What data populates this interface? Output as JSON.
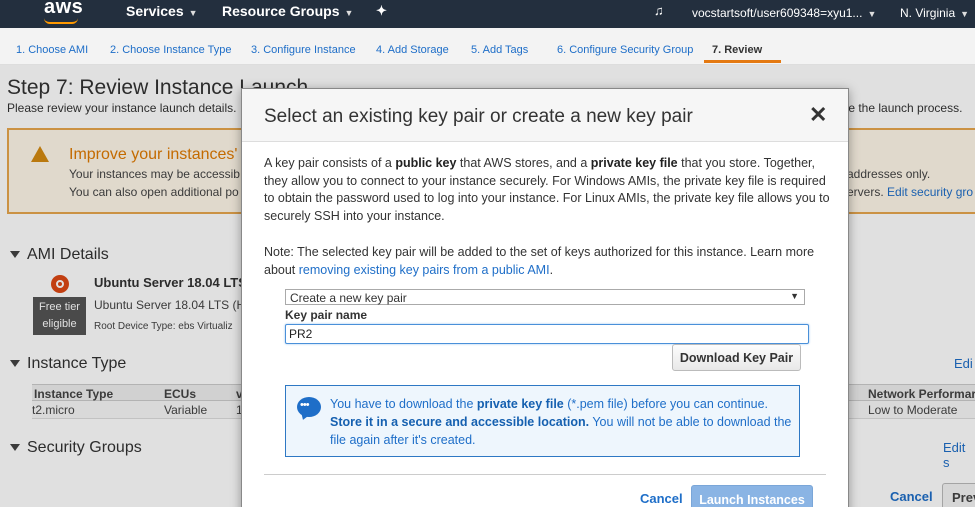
{
  "topnav": {
    "logo": "aws",
    "services": "Services",
    "resource_groups": "Resource Groups",
    "account": "vocstartsoft/user609348=xyu1...",
    "region": "N. Virginia"
  },
  "wizard": {
    "steps": [
      "1. Choose AMI",
      "2. Choose Instance Type",
      "3. Configure Instance",
      "4. Add Storage",
      "5. Add Tags",
      "6. Configure Security Group",
      "7. Review"
    ],
    "active_step": "7. Review"
  },
  "page": {
    "title": "Step 7: Review Instance Launch",
    "subtitle": "Please review your instance launch details.",
    "subtitle_tail": "te the launch process.",
    "warning": {
      "title": "Improve your instances' s",
      "line1": "Your instances may be accessib",
      "line2": "You can also open additional po",
      "line1_tail": "addresses only.",
      "line2_tail": "ervers.",
      "line2_link": "Edit security gro"
    },
    "ami_section": "AMI Details",
    "ami_name": "Ubuntu Server 18.04 LTS",
    "ami_desc": "Ubuntu Server 18.04 LTS (HV",
    "ami_meta": "Root Device Type: ebs    Virtualiz",
    "free_tier_1": "Free tier",
    "free_tier_2": "eligible",
    "instance_section": "Instance Type",
    "instance_edit": "Edi",
    "table": {
      "headers": [
        "Instance Type",
        "ECUs",
        "v",
        "Network Performar"
      ],
      "row": [
        "t2.micro",
        "Variable",
        "1",
        "Low to Moderate"
      ]
    },
    "security_section": "Security Groups",
    "security_edit": "Edit s",
    "cancel": "Cancel",
    "previous": "Prev"
  },
  "modal": {
    "title": "Select an existing key pair or create a new key pair",
    "close_glyph": "✕",
    "para1": {
      "t1": "A key pair consists of a ",
      "b1": "public key",
      "t2": " that AWS stores, and a ",
      "b2": "private key file",
      "t3": " that you store. Together, they allow you to connect to your instance securely. For Windows AMIs, the private key file is required to obtain the password used to log into your instance. For Linux AMIs, the private key file allows you to securely SSH into your instance."
    },
    "para2": {
      "t1": "Note: The selected key pair will be added to the set of keys authorized for this instance. Learn more about ",
      "link": "removing existing key pairs from a public AMI",
      "t2": "."
    },
    "select_value": "Create a new key pair",
    "key_label": "Key pair name",
    "key_value": "PR2",
    "download_button": "Download Key Pair",
    "info": {
      "t1": "You have to download the ",
      "b1": "private key file",
      "t2": " (*.pem file) before you can continue. ",
      "b2": "Store it in a secure and accessible location.",
      "t3": " You will not be able to download the file again after it's created."
    },
    "cancel": "Cancel",
    "launch": "Launch Instances"
  },
  "colors": {
    "nav_bg": "#232f3e",
    "link": "#1e6ec8",
    "warning_border": "#e8a74e",
    "launch_disabled": "#8ab4e4"
  }
}
